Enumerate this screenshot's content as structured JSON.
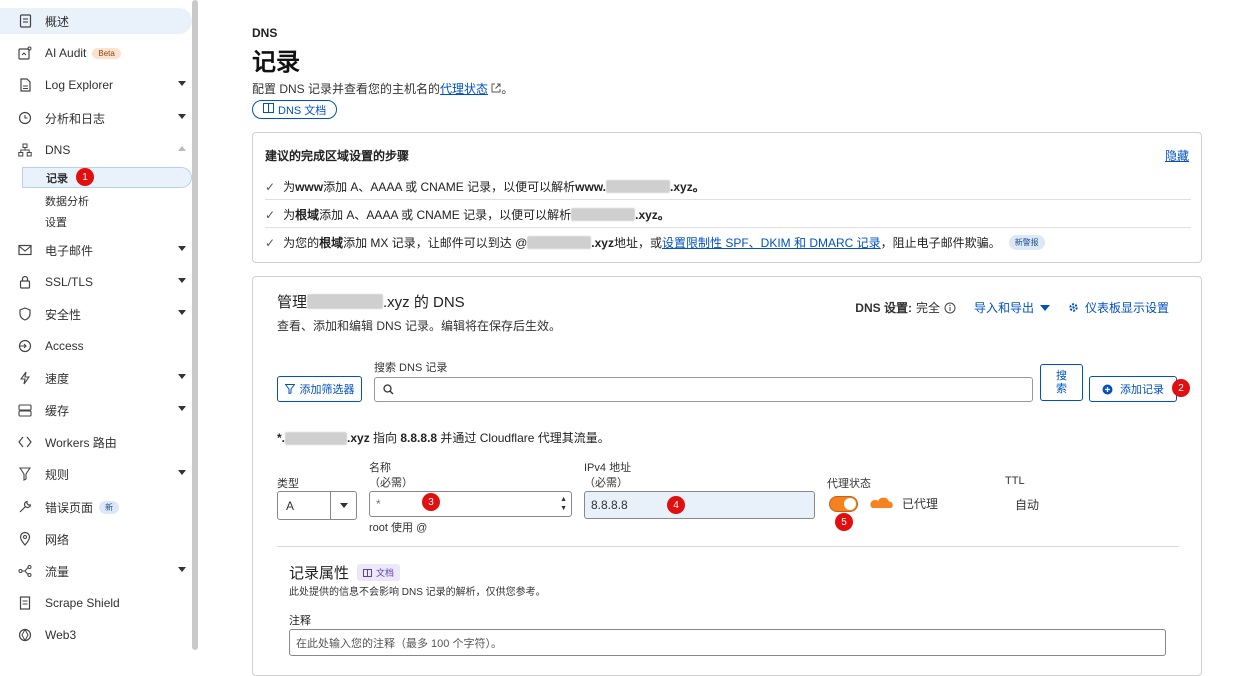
{
  "sidebar": {
    "items": [
      {
        "key": "overview",
        "label": "概述"
      },
      {
        "key": "ai-audit",
        "label": "AI Audit",
        "badge": "Beta"
      },
      {
        "key": "log-explorer",
        "label": "Log Explorer"
      },
      {
        "key": "analytics",
        "label": "分析和日志"
      },
      {
        "key": "dns",
        "label": "DNS"
      },
      {
        "key": "email",
        "label": "电子邮件"
      },
      {
        "key": "ssl",
        "label": "SSL/TLS"
      },
      {
        "key": "security",
        "label": "安全性"
      },
      {
        "key": "access",
        "label": "Access"
      },
      {
        "key": "speed",
        "label": "速度"
      },
      {
        "key": "cache",
        "label": "缓存"
      },
      {
        "key": "workers",
        "label": "Workers 路由"
      },
      {
        "key": "rules",
        "label": "规则"
      },
      {
        "key": "error-pages",
        "label": "错误页面",
        "badge": "新"
      },
      {
        "key": "network",
        "label": "网络"
      },
      {
        "key": "traffic",
        "label": "流量"
      },
      {
        "key": "scrape-shield",
        "label": "Scrape Shield"
      },
      {
        "key": "web3",
        "label": "Web3"
      }
    ],
    "dns_sub": [
      {
        "label": "记录"
      },
      {
        "label": "数据分析"
      },
      {
        "label": "设置"
      }
    ]
  },
  "markers": [
    "1",
    "2",
    "3",
    "4",
    "5"
  ],
  "header": {
    "breadcrumb": "DNS",
    "title": "记录",
    "desc_prefix": "配置 DNS 记录并查看您的主机名的",
    "desc_link": "代理状态",
    "desc_suffix": "。",
    "doc_button": "DNS 文档"
  },
  "steps": {
    "title": "建议的完成区域设置的步骤",
    "hide": "隐藏",
    "row1": {
      "a": "为 ",
      "b": "www",
      "c": " 添加 A、AAAA 或 CNAME 记录，以便可以解析 ",
      "d": "www.",
      "e": ".xyz。"
    },
    "row2": {
      "a": "为",
      "b": "根域",
      "c": "添加 A、AAAA 或 CNAME 记录，以便可以解析",
      "d": ".xyz。"
    },
    "row3": {
      "a": "为您的",
      "b": "根域",
      "c": "添加 MX 记录，让邮件可以到达 @",
      "d": ".xyz",
      "e": " 地址，或",
      "link": "设置限制性 SPF、DKIM 和 DMARC 记录",
      "f": "，阻止电子邮件欺骗。",
      "badge": "新警报"
    }
  },
  "manage": {
    "title_prefix": "管理 ",
    "title_suffix": ".xyz 的 DNS",
    "desc": "查看、添加和编辑 DNS 记录。编辑将在保存后生效。",
    "dns_setting_label": "DNS 设置:",
    "dns_setting_value": "完全",
    "import_export": "导入和导出",
    "dashboard_settings": "仪表板显示设置",
    "filter_button": "添加筛选器",
    "search_label": "搜索 DNS 记录",
    "search_button": "搜索",
    "add_record": "添加记录"
  },
  "record": {
    "desc_prefix": "*.",
    "desc_mid": ".xyz",
    "desc_a": " 指向 ",
    "desc_ip": "8.8.8.8",
    "desc_b": " 并通过 Cloudflare 代理其流量。",
    "type_label": "类型",
    "type_value": "A",
    "name_label": "名称",
    "name_required": "（必需）",
    "name_value": "*",
    "name_hint": "root 使用 @",
    "ip_label": "IPv4 地址",
    "ip_required": "（必需）",
    "ip_value": "8.8.8.8",
    "proxy_label": "代理状态",
    "proxy_value": "已代理",
    "ttl_label": "TTL",
    "ttl_value": "自动"
  },
  "attributes": {
    "title": "记录属性",
    "doc": "文档",
    "desc": "此处提供的信息不会影响 DNS 记录的解析，仅供您参考。",
    "comment_label": "注释",
    "comment_placeholder": "在此处输入您的注释（最多 100 个字符）。"
  },
  "colors": {
    "accent": "#0051c3",
    "marker": "#e10f0f",
    "proxy": "#f6821f"
  }
}
